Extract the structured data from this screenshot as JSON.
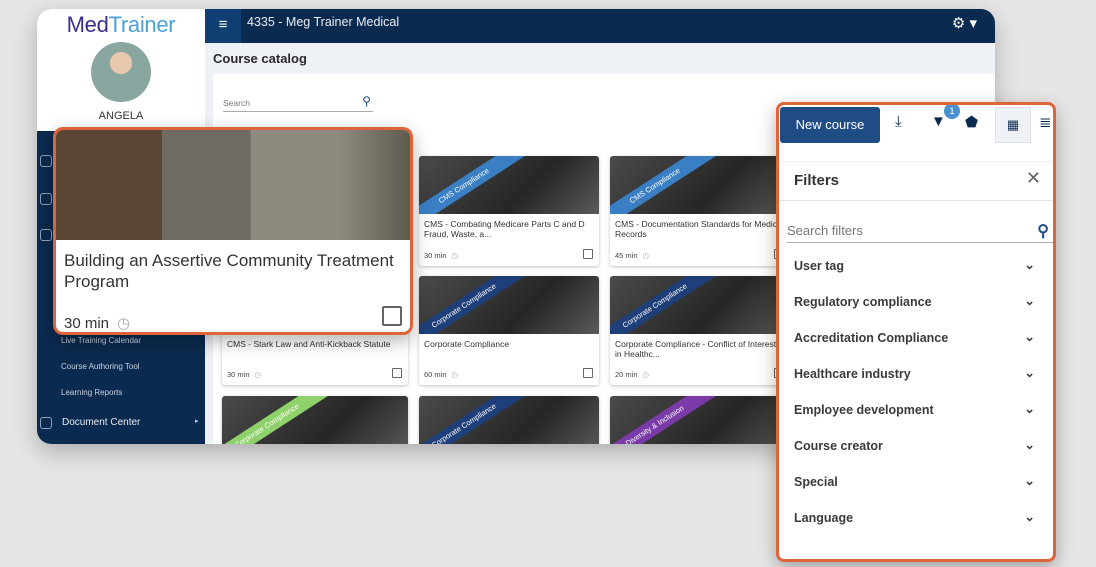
{
  "app": {
    "logo": "MedTrainer",
    "user": "ANGELA",
    "title": "4335 - Meg Trainer Medical",
    "page_title": "Course catalog"
  },
  "search": {
    "placeholder": "Search"
  },
  "sidebar": {
    "items": [
      "Live Training Calendar",
      "Course Authoring Tool",
      "Learning Reports"
    ],
    "document_center": "Document Center"
  },
  "featured": {
    "title": "Building an Assertive Community Treatment Program",
    "duration": "30 min"
  },
  "cards": [
    {
      "ribbon": "CMS Compliance",
      "ribbon_color": "#3a7fc4",
      "title": "CMS - Combating Medicare Parts C and D Fraud, Waste, a...",
      "duration": "30 min"
    },
    {
      "ribbon": "CMS Compliance",
      "ribbon_color": "#3a7fc4",
      "title": "CMS - Documentation Standards for Medical Records",
      "duration": "45 min"
    },
    {
      "ribbon": "",
      "ribbon_color": "",
      "title": "CMS - Stark Law and Anti-Kickback Statute",
      "duration": "30 min"
    },
    {
      "ribbon": "Corporate Compliance",
      "ribbon_color": "#1e3f7a",
      "title": "Corporate Compliance",
      "duration": "60 min"
    },
    {
      "ribbon": "Corporate Compliance",
      "ribbon_color": "#1e3f7a",
      "title": "Corporate Compliance - Conflict of Interest in Healthc...",
      "duration": "20 min"
    },
    {
      "ribbon": "Corporate Compliance",
      "ribbon_color": "#8fd16a",
      "title": "",
      "duration": ""
    },
    {
      "ribbon": "Corporate Compliance",
      "ribbon_color": "#1e3f7a",
      "title": "",
      "duration": ""
    },
    {
      "ribbon": "Diversity & Inclusion",
      "ribbon_color": "#7a3aa8",
      "title": "",
      "duration": ""
    }
  ],
  "filters": {
    "new_course": "New course",
    "filter_count": "1",
    "heading": "Filters",
    "search_placeholder": "Search filters",
    "items": [
      "User tag",
      "Regulatory compliance",
      "Accreditation Compliance",
      "Healthcare industry",
      "Employee development",
      "Course creator",
      "Special",
      "Language"
    ]
  },
  "colors": {
    "accent": "#e0643a",
    "navy": "#0b2a4f",
    "primary": "#1f4c85"
  }
}
